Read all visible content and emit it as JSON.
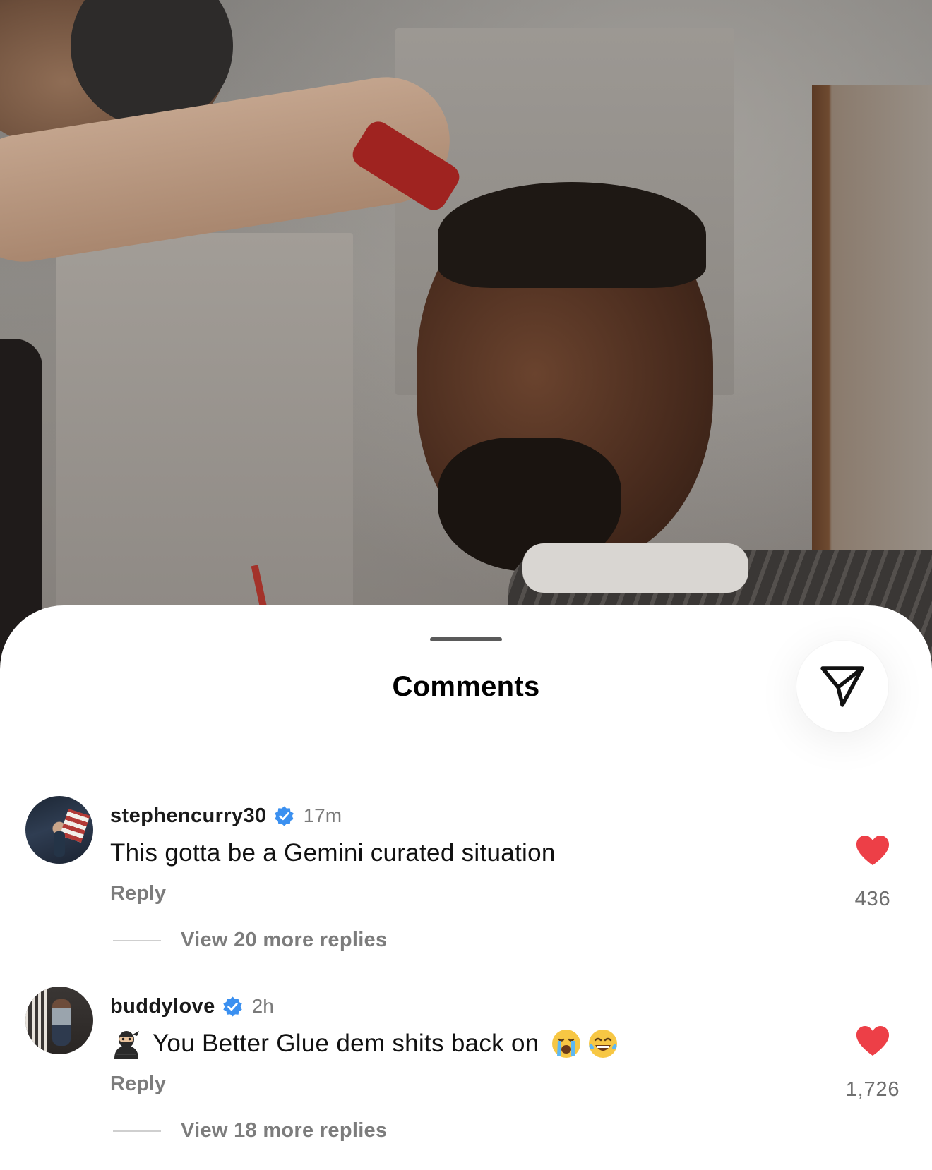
{
  "post": {
    "image_description_icon": "post-photo"
  },
  "sheet": {
    "title": "Comments",
    "share_icon": "send-icon"
  },
  "comments": [
    {
      "username": "stephencurry30",
      "verified": true,
      "time": "17m",
      "text": "This gotta be a Gemini curated situation",
      "reply_label": "Reply",
      "view_replies": "View 20 more replies",
      "likes": "436",
      "liked": true
    },
    {
      "username": "buddylove",
      "verified": true,
      "time": "2h",
      "lead_emoji": "ninja-emoji",
      "text": "You Better Glue dem shits back on",
      "trailing_emojis": [
        "loudly-crying-face-emoji",
        "face-with-tears-of-joy-emoji"
      ],
      "reply_label": "Reply",
      "view_replies": "View 18 more replies",
      "likes": "1,726",
      "liked": true
    }
  ],
  "colors": {
    "like_red": "#ed3f47",
    "verified_blue": "#3b90f0",
    "secondary_text": "#7c7c7c"
  }
}
